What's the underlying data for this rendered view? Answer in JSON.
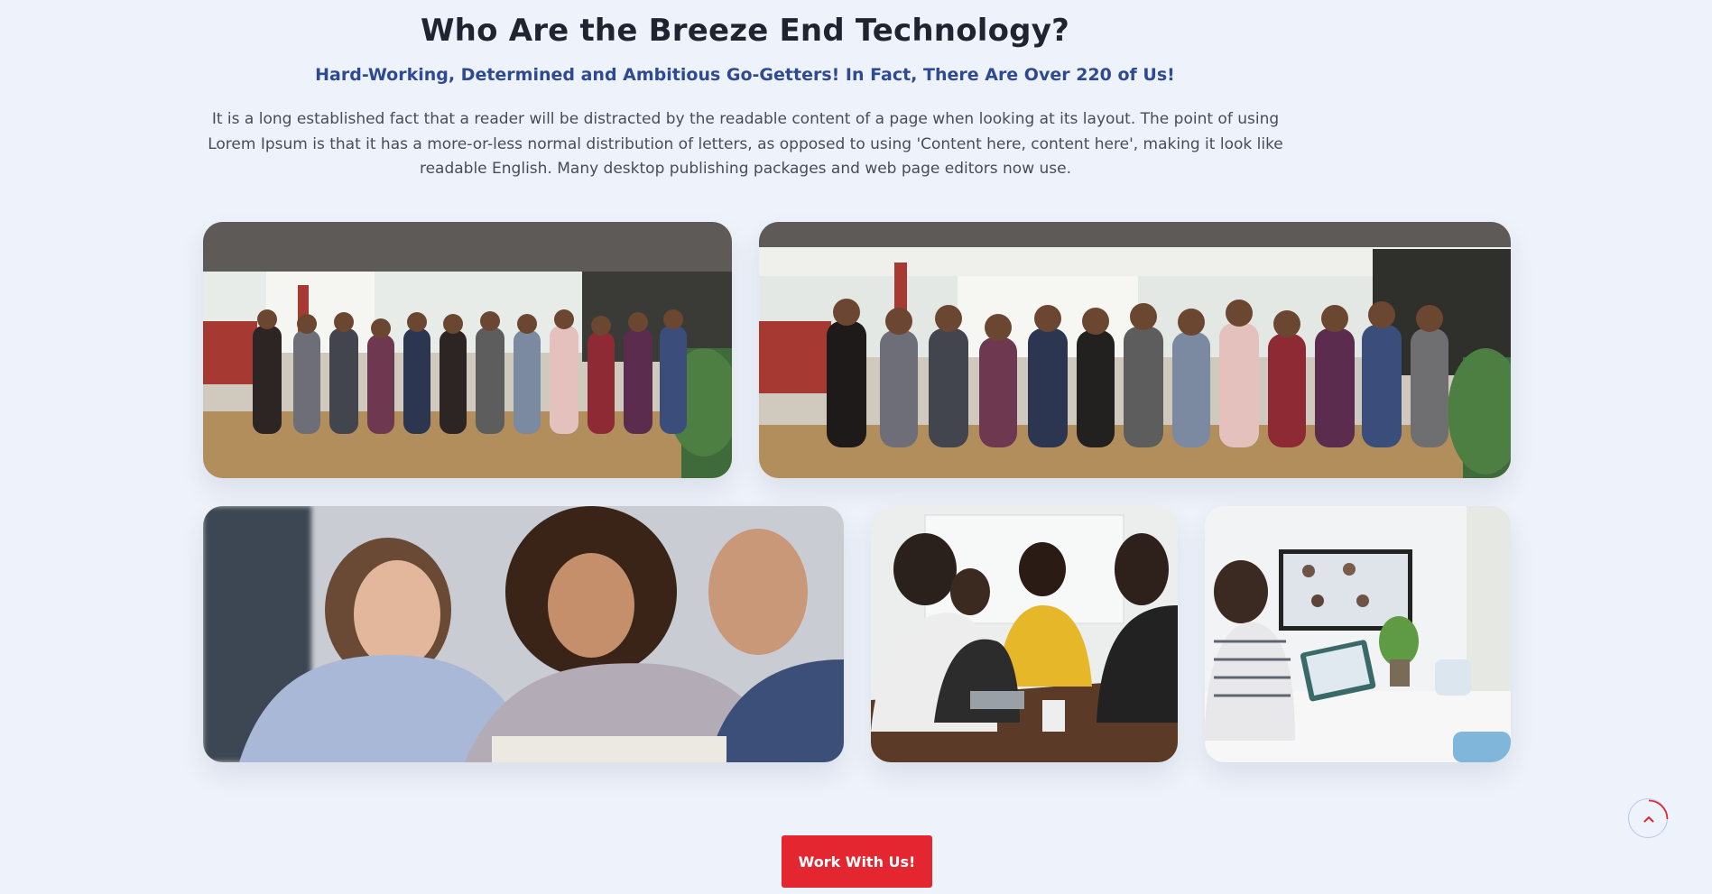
{
  "section": {
    "title": "Who Are the Breeze End Technology?",
    "subtitle": "Hard-Working, Determined and Ambitious Go-Getters! In Fact, There Are Over 220 of Us!",
    "intro": "It is a long established fact that a reader will be distracted by the readable content of a page when looking at its layout. The point of using Lorem Ipsum is that it has a more-or-less normal distribution of letters, as opposed to using 'Content here, content here', making it look like readable English. Many desktop publishing packages and web page editors now use."
  },
  "cta": {
    "label": "Work With Us!"
  },
  "back_to_top": {
    "icon": "chevron-up-icon"
  },
  "colors": {
    "background": "#eef2fa",
    "title": "#1f2430",
    "subtitle": "#2f4a94",
    "accent": "#e3262f"
  }
}
